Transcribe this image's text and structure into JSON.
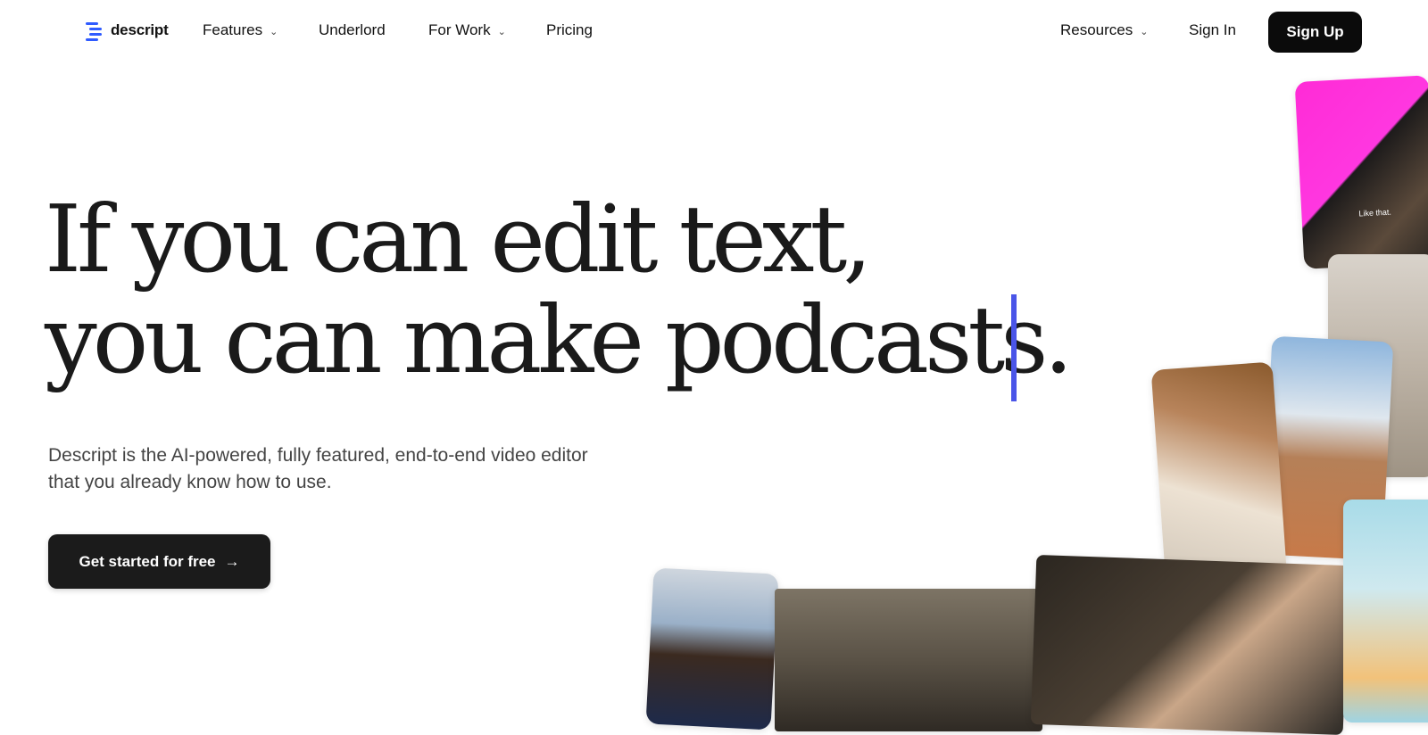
{
  "brand": {
    "name": "descript",
    "accent": "#2f5bff"
  },
  "nav": {
    "left": [
      {
        "label": "Features",
        "has_dropdown": true
      },
      {
        "label": "Underlord",
        "has_dropdown": false
      },
      {
        "label": "For Work",
        "has_dropdown": true
      },
      {
        "label": "Pricing",
        "has_dropdown": false
      }
    ],
    "resources": {
      "label": "Resources",
      "has_dropdown": true
    },
    "sign_in": "Sign In",
    "sign_up": "Sign Up"
  },
  "hero": {
    "headline_line1": "If you can edit text,",
    "headline_line2": "you can make podcasts.",
    "caret_color": "#4a55e8",
    "subtext_line1": "Descript is the AI-powered, fully featured, end-to-end video editor",
    "subtext_line2": "that you already know how to use.",
    "cta_label": "Get started for free",
    "cta_icon": "arrow-right-icon"
  },
  "collage": {
    "caption_label": "Like that."
  }
}
